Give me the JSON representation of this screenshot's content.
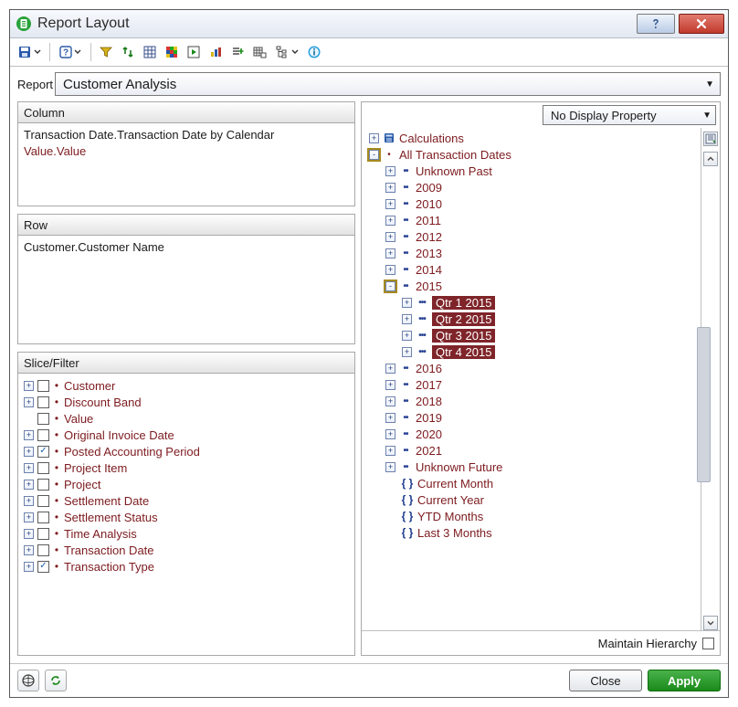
{
  "window": {
    "title": "Report Layout"
  },
  "report": {
    "label": "Report",
    "selected": "Customer Analysis"
  },
  "panels": {
    "column": {
      "title": "Column",
      "items": [
        {
          "text": "Transaction Date.Transaction Date by Calendar",
          "red": false
        },
        {
          "text": "Value.Value",
          "red": true
        }
      ]
    },
    "row": {
      "title": "Row",
      "items": [
        {
          "text": "Customer.Customer Name",
          "red": false
        }
      ]
    },
    "slice": {
      "title": "Slice/Filter",
      "items": [
        {
          "label": "Customer",
          "checked": false,
          "expandable": true
        },
        {
          "label": "Discount Band",
          "checked": false,
          "expandable": true
        },
        {
          "label": "Value",
          "checked": false,
          "expandable": false
        },
        {
          "label": "Original Invoice Date",
          "checked": false,
          "expandable": true
        },
        {
          "label": "Posted Accounting Period",
          "checked": true,
          "expandable": true
        },
        {
          "label": "Project Item",
          "checked": false,
          "expandable": true
        },
        {
          "label": "Project",
          "checked": false,
          "expandable": true
        },
        {
          "label": "Settlement Date",
          "checked": false,
          "expandable": true
        },
        {
          "label": "Settlement Status",
          "checked": false,
          "expandable": true
        },
        {
          "label": "Time Analysis",
          "checked": false,
          "expandable": true
        },
        {
          "label": "Transaction Date",
          "checked": false,
          "expandable": true
        },
        {
          "label": "Transaction Type",
          "checked": true,
          "expandable": true
        }
      ]
    }
  },
  "display_property": {
    "selected": "No Display Property"
  },
  "tree": {
    "root": {
      "label": "Calculations",
      "icon": "calc"
    },
    "group": {
      "label": "All Transaction Dates",
      "highlight": true
    },
    "years_before": [
      {
        "label": "Unknown Past"
      },
      {
        "label": "2009"
      },
      {
        "label": "2010"
      },
      {
        "label": "2011"
      },
      {
        "label": "2012"
      },
      {
        "label": "2013"
      },
      {
        "label": "2014"
      }
    ],
    "expanded_year": {
      "label": "2015",
      "highlight": true,
      "quarters": [
        {
          "label": "Qtr 1 2015",
          "selected": true
        },
        {
          "label": "Qtr 2 2015",
          "selected": true
        },
        {
          "label": "Qtr 3 2015",
          "selected": true
        },
        {
          "label": "Qtr 4 2015",
          "selected": true
        }
      ]
    },
    "years_after": [
      {
        "label": "2016"
      },
      {
        "label": "2017"
      },
      {
        "label": "2018"
      },
      {
        "label": "2019"
      },
      {
        "label": "2020"
      },
      {
        "label": "2021"
      },
      {
        "label": "Unknown Future"
      }
    ],
    "calcs": [
      {
        "label": "Current Month"
      },
      {
        "label": "Current Year"
      },
      {
        "label": "YTD Months"
      },
      {
        "label": "Last 3 Months"
      }
    ]
  },
  "footer": {
    "maintain_hierarchy": "Maintain Hierarchy"
  },
  "buttons": {
    "close": "Close",
    "apply": "Apply"
  }
}
